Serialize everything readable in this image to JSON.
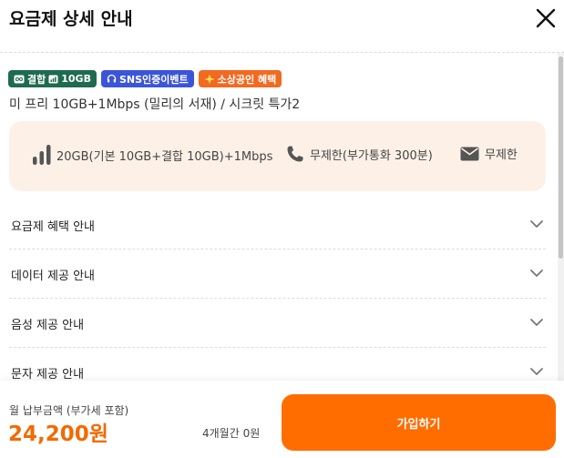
{
  "header": {
    "title": "요금제 상세 안내"
  },
  "badges": [
    {
      "label": "결합",
      "extra": "10GB",
      "color": "#1f6b4f"
    },
    {
      "label": "SNS인증이벤트",
      "color": "#3b55d9"
    },
    {
      "label": "소상공인 혜택",
      "color": "#f26a22"
    }
  ],
  "plan": {
    "name": "미 프리 10GB+1Mbps (밀리의 서재) / 시크릿 특가2"
  },
  "specs": {
    "data": "20GB(기본 10GB+결합 10GB)+1Mbps",
    "voice": "무제한(부가통화 300분)",
    "sms": "무제한"
  },
  "accordion": [
    {
      "label": "요금제 혜택 안내"
    },
    {
      "label": "데이터 제공 안내"
    },
    {
      "label": "음성 제공 안내"
    },
    {
      "label": "문자 제공 안내"
    }
  ],
  "footer": {
    "fee_label": "월 납부금액 (부가세 포함)",
    "fee_value": "24,200원",
    "promo": "4개월간 0원",
    "join_label": "가입하기"
  },
  "colors": {
    "accent": "#ff6d00",
    "summary_bg": "#fdf1e7"
  }
}
